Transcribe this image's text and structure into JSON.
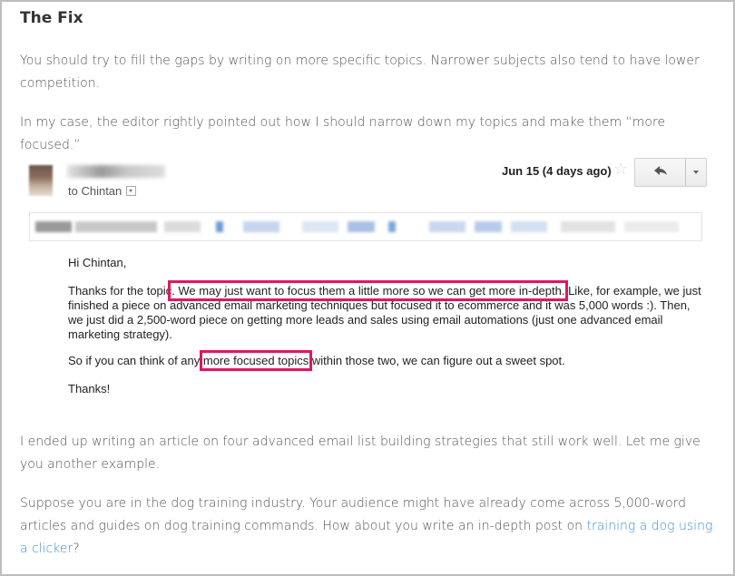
{
  "heading": "The Fix",
  "para1": "You should try to fill the gaps by writing on more specific topics. Narrower subjects also tend to have lower competition.",
  "para2": "In my case, the editor rightly pointed out how I should narrow down my topics and make them “more focused.”",
  "email": {
    "to": "to Chintan",
    "date": "Jun 15 (4 days ago)",
    "star_icon": "☆",
    "reply_icon": "reply-arrow-icon",
    "greeting": "Hi Chintan,",
    "body1_before": "Thanks for the topic",
    "body1_highlight": ". We may just want to focus them a little more so we can get more in-depth.",
    "body1_after": " Like, for example, we just finished a piece on advanced email marketing techniques but focused it to ecommerce and it was 5,000 words :). Then, we just did a 2,500-word piece on getting more leads and sales using email automations (just one advanced email marketing strategy).",
    "body2_before": "So if you can think of any ",
    "body2_highlight": "more focused topics",
    "body2_after": " within those two, we can figure out a sweet spot.",
    "thanks": "Thanks!",
    "highlight_color": "#d81b60"
  },
  "para3": "I ended up writing an article on four advanced email list building strategies that still work well. Let me give you another example.",
  "para4_before": "Suppose you are in the dog training industry. Your audience might have already come across 5,000-word articles and guides on dog training commands. How about you write an in-depth post on ",
  "para4_link": "training a dog using a clicker",
  "para4_after": "?",
  "colors": {
    "link": "#3d8fd1",
    "text": "#555555",
    "border": "#bdbdbd"
  }
}
